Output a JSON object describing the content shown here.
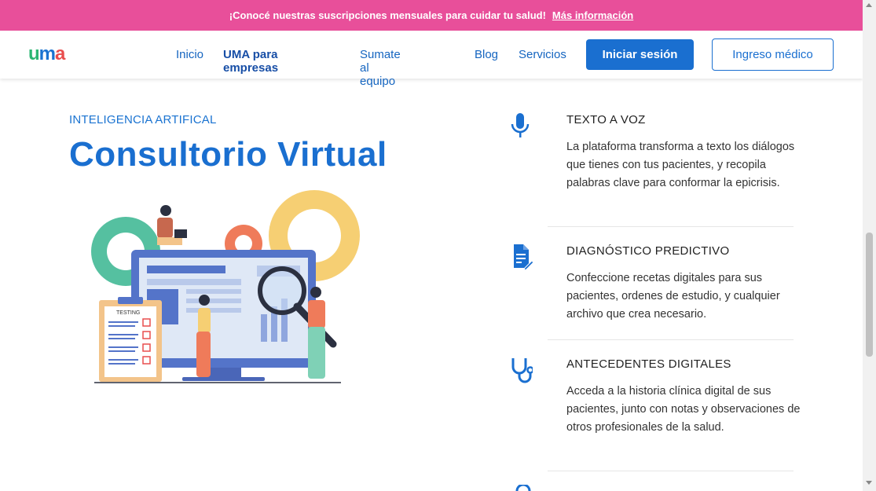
{
  "promo": {
    "text": "¡Conocé nuestras suscripciones mensuales para cuidar tu salud!",
    "link": "Más información"
  },
  "header": {
    "logo": {
      "u": "u",
      "m": "m",
      "a": "a"
    },
    "nav": [
      "Inicio",
      "UMA para empresas",
      "Sumate al equipo",
      "Blog",
      "Servicios"
    ],
    "login_button": "Iniciar sesión",
    "doctor_button": "Ingreso médico"
  },
  "hero": {
    "eyebrow": "INTELIGENCIA ARTIFICAL",
    "title": "Consultorio Virtual",
    "illustration_label": "TESTING"
  },
  "features": [
    {
      "icon": "microphone-icon",
      "title": "TEXTO A VOZ",
      "description": "La plataforma transforma a texto los diálogos que tienes con tus pacientes, y recopila palabras clave para conformar la epicrisis."
    },
    {
      "icon": "document-edit-icon",
      "title": "DIAGNÓSTICO PREDICTIVO",
      "description": "Confeccione recetas digitales para sus pacientes, ordenes de estudio, y cualquier archivo que crea necesario."
    },
    {
      "icon": "stethoscope-icon",
      "title": "ANTECEDENTES DIGITALES",
      "description": "Acceda a la historia clínica digital de sus pacientes, junto con notas y observaciones de otros profesionales de la salud."
    }
  ],
  "colors": {
    "promo_bg": "#e84f9a",
    "brand_blue": "#1a6fd0",
    "logo_green": "#2bb673",
    "logo_red": "#e94e4e"
  }
}
